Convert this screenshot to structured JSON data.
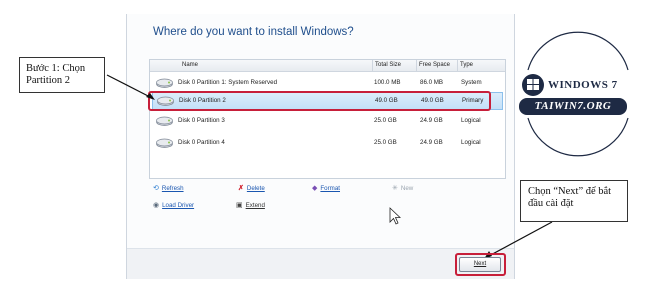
{
  "dialog": {
    "heading": "Where do you want to install Windows?",
    "columns": [
      "Name",
      "Total Size",
      "Free Space",
      "Type"
    ],
    "partitions": [
      {
        "name": "Disk 0 Partition 1: System Reserved",
        "total": "100.0 MB",
        "free": "86.0 MB",
        "type": "System",
        "selected": false
      },
      {
        "name": "Disk 0 Partition 2",
        "total": "49.0 GB",
        "free": "49.0 GB",
        "type": "Primary",
        "selected": true
      },
      {
        "name": "Disk 0 Partition 3",
        "total": "25.0 GB",
        "free": "24.9 GB",
        "type": "Logical",
        "selected": false
      },
      {
        "name": "Disk 0 Partition 4",
        "total": "25.0 GB",
        "free": "24.9 GB",
        "type": "Logical",
        "selected": false
      }
    ],
    "actions": {
      "refresh": "Refresh",
      "delete": "Delete",
      "format": "Format",
      "new": "New",
      "load_driver": "Load Driver",
      "extend": "Extend"
    },
    "next_label": "Next"
  },
  "annotations": {
    "step1": "Bước 1: Chọn Partition 2",
    "next_hint": "Chọn “Next” để bắt đầu cài đặt"
  },
  "logo": {
    "line1": "WINDOWS 7",
    "line2": "TAIWIN7.ORG"
  },
  "colors": {
    "highlight": "#c71f3a",
    "heading": "#1f4e8c",
    "link": "#1a56b0",
    "logo_dark": "#1e2a44"
  }
}
